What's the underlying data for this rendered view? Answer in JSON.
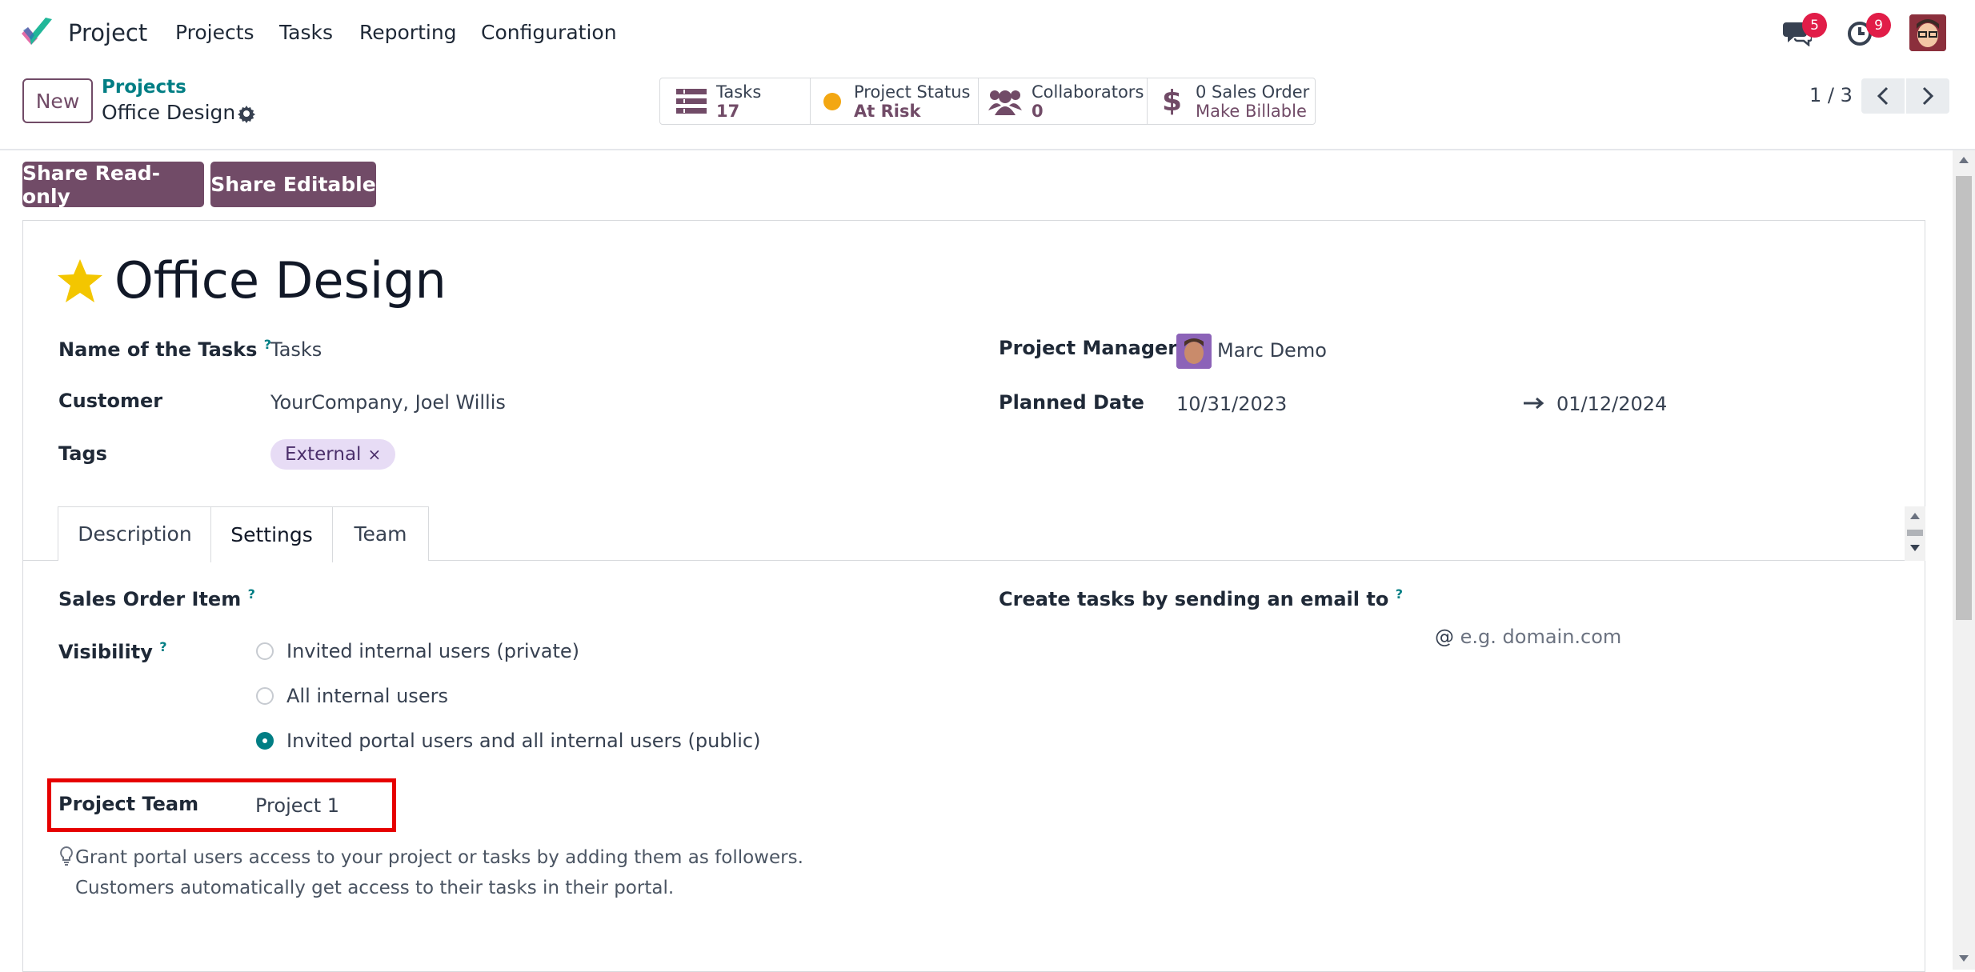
{
  "nav": {
    "app_name": "Project",
    "menu": [
      "Projects",
      "Tasks",
      "Reporting",
      "Configuration"
    ],
    "messages_count": "5",
    "activities_count": "9"
  },
  "control": {
    "new_label": "New",
    "breadcrumb_parent": "Projects",
    "breadcrumb_current": "Office Design",
    "stats": {
      "tasks_label": "Tasks",
      "tasks_value": "17",
      "status_label": "Project Status",
      "status_value": "At Risk",
      "collab_label": "Collaborators",
      "collab_value": "0",
      "sales_label": "0 Sales Order",
      "sales_value": "Make Billable"
    },
    "pager": "1 / 3"
  },
  "share": {
    "readonly": "Share Read-only",
    "editable": "Share Editable"
  },
  "form": {
    "title": "Office Design",
    "tasks_name_label": "Name of the Tasks",
    "tasks_name_value": "Tasks",
    "customer_label": "Customer",
    "customer_value": "YourCompany, Joel Willis",
    "tags_label": "Tags",
    "tag": "External",
    "manager_label": "Project Manager",
    "manager_value": "Marc Demo",
    "planned_label": "Planned Date",
    "planned_start": "10/31/2023",
    "planned_end": "01/12/2024",
    "help_mark": "?"
  },
  "tabs": [
    "Description",
    "Settings",
    "Team"
  ],
  "settings": {
    "sale_item_label": "Sales Order Item",
    "email_label": "Create tasks by sending an email to",
    "email_placeholder": "e.g. domain.com",
    "visibility_label": "Visibility",
    "visibility_options": [
      "Invited internal users (private)",
      "All internal users",
      "Invited portal users and all internal users (public)"
    ],
    "visibility_selected_index": 2,
    "team_label": "Project Team",
    "team_value": "Project 1",
    "hint": "Grant portal users access to your project or tasks by adding them as followers. Customers automatically get access to their tasks in their portal."
  },
  "colors": {
    "brand": "#714b67",
    "accent": "#017e84",
    "highlight_box": "#e60000",
    "status_at_risk": "#f3a712"
  }
}
